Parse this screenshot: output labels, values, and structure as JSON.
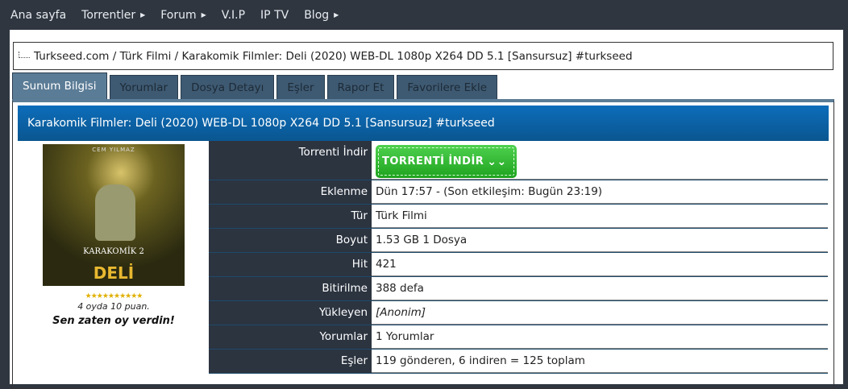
{
  "nav": {
    "items": [
      {
        "label": "Ana sayfa",
        "caret": false
      },
      {
        "label": "Torrentler",
        "caret": true
      },
      {
        "label": "Forum",
        "caret": true
      },
      {
        "label": "V.I.P",
        "caret": false
      },
      {
        "label": "IP TV",
        "caret": false
      },
      {
        "label": "Blog",
        "caret": true
      }
    ]
  },
  "breadcrumb": "Turkseed.com / Türk Filmi / Karakomik Filmler: Deli (2020) WEB-DL 1080p X264 DD 5.1 [Sansursuz] #turkseed",
  "tabs": [
    "Sunum Bilgisi",
    "Yorumlar",
    "Dosya Detayı",
    "Eşler",
    "Rapor Et",
    "Favorilere Ekle"
  ],
  "title": "Karakomik Filmler: Deli (2020) WEB-DL 1080p X264 DD 5.1 [Sansursuz] #turkseed",
  "poster": {
    "top": "CEM YILMAZ",
    "brand": "KARAKOMİK 2",
    "name": "DELİ"
  },
  "rating": {
    "stars": "★★★★★★★★★★",
    "votes": "4 oyda 10 puan.",
    "voted": "Sen zaten oy verdin!",
    "score": 10,
    "max": 10
  },
  "details": {
    "download_label": "Torrenti İndir",
    "download_button": "TORRENTİ İNDİR",
    "rows": [
      {
        "label": "Eklenme",
        "value": "Dün 17:57 - (Son etkileşim: Bugün 23:19)"
      },
      {
        "label": "Tür",
        "value": "Türk Filmi"
      },
      {
        "label": "Boyut",
        "value": "1.53 GB 1 Dosya"
      },
      {
        "label": "Hit",
        "value": "421"
      },
      {
        "label": "Bitirilme",
        "value": "388 defa"
      },
      {
        "label": "Yükleyen",
        "value": "[Anonim]"
      },
      {
        "label": "Yorumlar",
        "value": "1 Yorumlar"
      },
      {
        "label": "Eşler",
        "value": "119 gönderen, 6 indiren = 125 toplam"
      }
    ]
  }
}
